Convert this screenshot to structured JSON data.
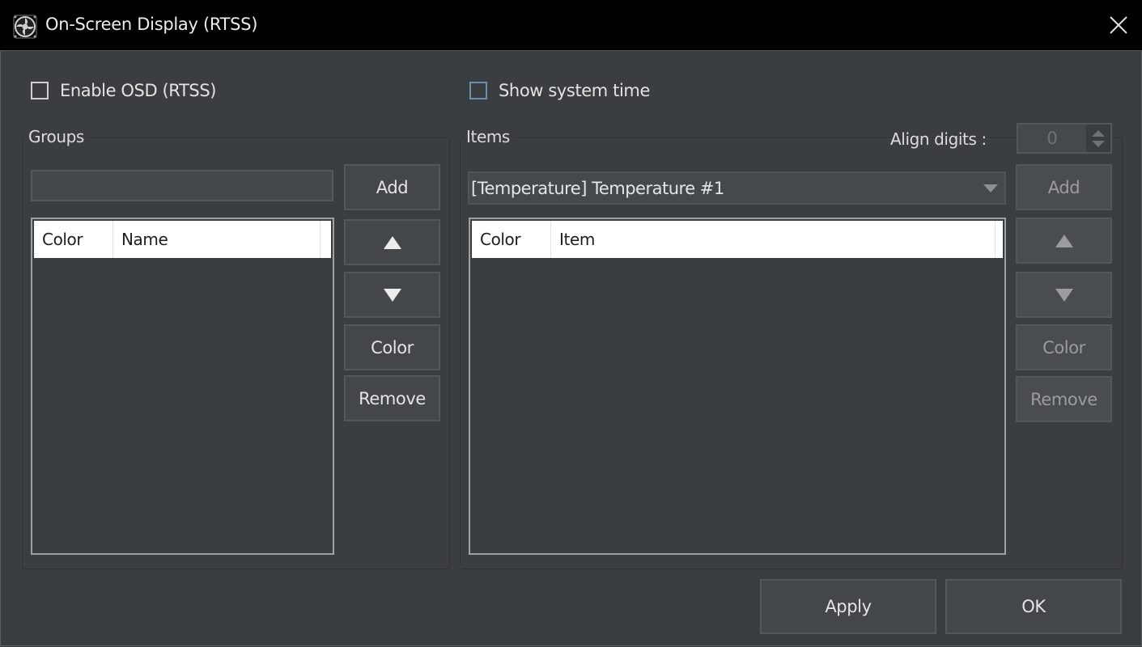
{
  "window": {
    "title": "On-Screen Display (RTSS)",
    "app_icon": "fan-icon",
    "close_icon": "close-icon"
  },
  "options": {
    "enable_osd": {
      "label": "Enable OSD (RTSS)",
      "checked": false
    },
    "show_system_time": {
      "label": "Show system time",
      "checked": false
    }
  },
  "groups": {
    "title": "Groups",
    "name_input": {
      "value": "",
      "placeholder": ""
    },
    "columns": [
      "Color",
      "Name"
    ],
    "rows": [],
    "buttons": {
      "add": "Add",
      "move_up": "up-arrow-icon",
      "move_down": "down-arrow-icon",
      "color": "Color",
      "remove": "Remove"
    }
  },
  "items": {
    "title": "Items",
    "align_digits_label": "Align digits :",
    "align_digits_value": "0",
    "selected_item": "[Temperature] Temperature #1",
    "columns": [
      "Color",
      "Item"
    ],
    "rows": [],
    "buttons": {
      "add": "Add",
      "move_up": "up-arrow-icon",
      "move_down": "down-arrow-icon",
      "color": "Color",
      "remove": "Remove"
    },
    "buttons_enabled": false
  },
  "footer": {
    "apply": "Apply",
    "ok": "OK"
  }
}
